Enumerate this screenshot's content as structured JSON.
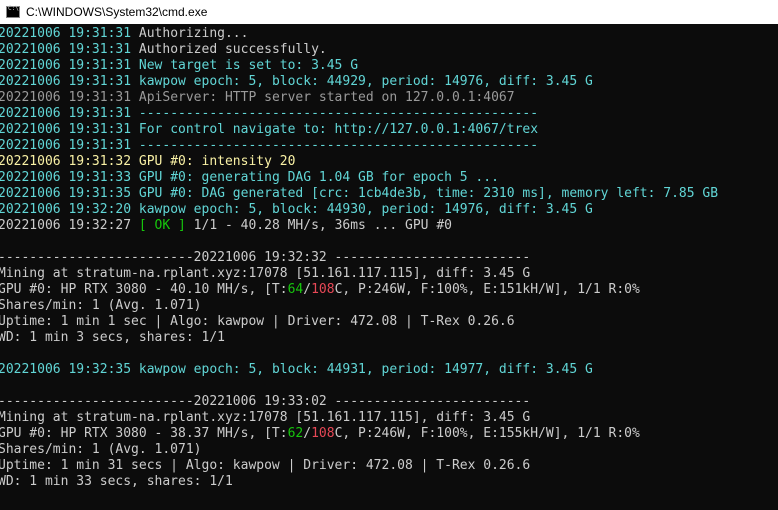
{
  "window": {
    "title": "C:\\WINDOWS\\System32\\cmd.exe",
    "icon": "cmd-icon"
  },
  "colors": {
    "background": "#0c0c0c",
    "white": "#cccccc",
    "gray": "#9a9a9a",
    "teal": "#61d6d6",
    "yellow": "#f9f1a5",
    "green": "#16c60c",
    "red": "#e74856"
  },
  "lines": [
    {
      "ts": "20221006 19:31:31",
      "msg": " Authorizing..."
    },
    {
      "ts": "20221006 19:31:31",
      "msg": " Authorized successfully."
    },
    {
      "ts": "20221006 19:31:31",
      "msg": " New target is set to: 3.45 G"
    },
    {
      "ts": "20221006 19:31:31",
      "msg": " kawpow epoch: 5, block: 44929, period: 14976, diff: 3.45 G"
    },
    {
      "ts": "20221006 19:31:31",
      "msg": " ApiServer: HTTP server started on 127.0.0.1:4067"
    },
    {
      "ts": "20221006 19:31:31",
      "msg": " ---------------------------------------------------"
    },
    {
      "ts": "20221006 19:31:31",
      "msg": " For control navigate to: http://127.0.0.1:4067/trex"
    },
    {
      "ts": "20221006 19:31:31",
      "msg": " ---------------------------------------------------"
    },
    {
      "ts": "20221006 19:31:32",
      "msg": " GPU #0: intensity 20"
    },
    {
      "ts": "20221006 19:31:33",
      "msg": " GPU #0: generating DAG 1.04 GB for epoch 5 ..."
    },
    {
      "ts": "20221006 19:31:35",
      "msg": " GPU #0: DAG generated [crc: 1cb4de3b, time: 2310 ms], memory left: 7.85 GB"
    },
    {
      "ts": "20221006 19:32:20",
      "msg": " kawpow epoch: 5, block: 44930, period: 14976, diff: 3.45 G"
    },
    {
      "ts": "20221006 19:32:27",
      "ok": " [ OK ]",
      "msg": " 1/1 - 40.28 MH/s, 36ms ... GPU #0"
    }
  ],
  "report1": {
    "header": "-------------------------20221006 19:32:32 -------------------------",
    "pool": "Mining at stratum-na.rplant.xyz:17078 [51.161.117.115], diff: 3.45 G",
    "gpu_pre": "GPU #0: HP RTX 3080 - 40.10 MH/s, [T:",
    "gpu_temp": "64",
    "gpu_sep": "/",
    "gpu_limit": "108",
    "gpu_post": "C, P:246W, F:100%, E:151kH/W], 1/1 R:0%",
    "shares": "Shares/min: 1 (Avg. 1.071)",
    "uptime": "Uptime: 1 min 1 sec | Algo: kawpow | Driver: 472.08 | T-Rex 0.26.6",
    "wd": "WD: 1 min 3 secs, shares: 1/1"
  },
  "epoch_line": {
    "ts": "20221006 19:32:35",
    "msg": " kawpow epoch: 5, block: 44931, period: 14977, diff: 3.45 G"
  },
  "report2": {
    "header": "-------------------------20221006 19:33:02 -------------------------",
    "pool": "Mining at stratum-na.rplant.xyz:17078 [51.161.117.115], diff: 3.45 G",
    "gpu_pre": "GPU #0: HP RTX 3080 - 38.37 MH/s, [T:",
    "gpu_temp": "62",
    "gpu_sep": "/",
    "gpu_limit": "108",
    "gpu_post": "C, P:246W, F:100%, E:155kH/W], 1/1 R:0%",
    "shares": "Shares/min: 1 (Avg. 1.071)",
    "uptime": "Uptime: 1 min 31 secs | Algo: kawpow | Driver: 472.08 | T-Rex 0.26.6",
    "wd": "WD: 1 min 33 secs, shares: 1/1"
  }
}
